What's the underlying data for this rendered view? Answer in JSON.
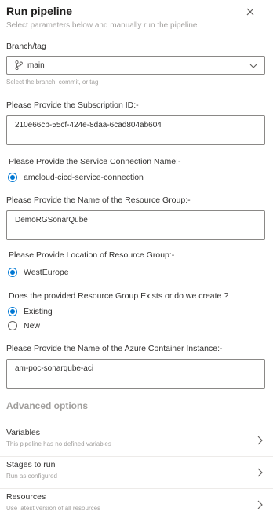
{
  "panel": {
    "title": "Run pipeline",
    "subtitle": "Select parameters below and manually run the pipeline"
  },
  "branch": {
    "label": "Branch/tag",
    "value": "main",
    "help": "Select the branch, commit, or tag"
  },
  "subscription": {
    "label": "Please Provide the Subscription ID:-",
    "value": "210e66cb-55cf-424e-8daa-6cad804ab604"
  },
  "service_connection": {
    "label": "Please Provide the Service Connection Name:-",
    "options": [
      {
        "label": "amcloud-cicd-service-connection",
        "selected": true
      }
    ]
  },
  "resource_group": {
    "label": "Please Provide the Name of the Resource Group:-",
    "value": "DemoRGSonarQube"
  },
  "location": {
    "label": "Please Provide Location of Resource Group:-",
    "options": [
      {
        "label": "WestEurope",
        "selected": true
      }
    ]
  },
  "rg_exists": {
    "label": "Does the provided Resource Group Exists or do we create ?",
    "options": [
      {
        "label": "Existing",
        "selected": true
      },
      {
        "label": "New",
        "selected": false
      }
    ]
  },
  "container_instance": {
    "label": "Please Provide the Name of the Azure Container Instance:-",
    "value": "am-poc-sonarqube-aci"
  },
  "advanced": {
    "heading": "Advanced options",
    "items": [
      {
        "title": "Variables",
        "subtitle": "This pipeline has no defined variables"
      },
      {
        "title": "Stages to run",
        "subtitle": "Run as configured"
      },
      {
        "title": "Resources",
        "subtitle": "Use latest version of all resources"
      }
    ]
  },
  "colors": {
    "accent": "#0078d4",
    "muted_text": "#a19f9d",
    "border": "#8a8886"
  },
  "icons": [
    "close-icon",
    "branch-icon",
    "chevron-down-icon",
    "chevron-right-icon"
  ]
}
